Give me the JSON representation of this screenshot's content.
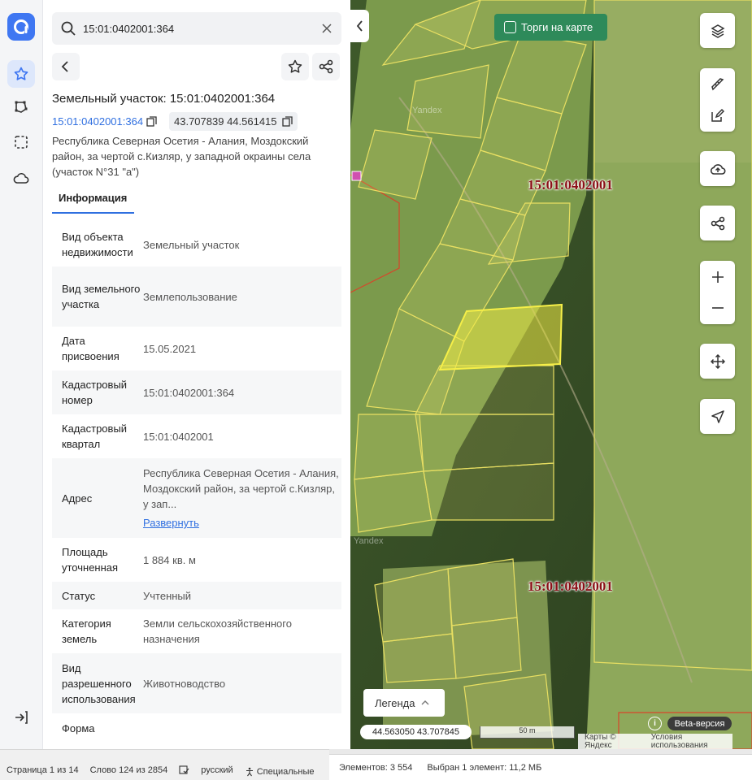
{
  "search": {
    "value": "15:01:0402001:364",
    "placeholder": ""
  },
  "object": {
    "title": "Земельный участок: 15:01:0402001:364",
    "cad_number": "15:01:0402001:364",
    "coords": "43.707839 44.561415",
    "address": "Республика Северная Осетия - Алания, Моздокский район, за чертой с.Кизляр, у западной окраины села (участок N°31 \"а\")"
  },
  "tabs": {
    "info": "Информация"
  },
  "info_rows": [
    {
      "key": "Вид объекта недвижимости",
      "value": "Земельный участок"
    },
    {
      "key": "Вид земельного участка",
      "value": "Землепользование"
    },
    {
      "key": "Дата присвоения",
      "value": "15.05.2021"
    },
    {
      "key": "Кадастровый номер",
      "value": "15:01:0402001:364"
    },
    {
      "key": "Кадастровый квартал",
      "value": "15:01:0402001"
    },
    {
      "key": "Адрес",
      "value": "Республика Северная Осетия - Алания, Моздокский район, за чертой с.Кизляр, у зап...",
      "link": "Развернуть"
    },
    {
      "key": "Площадь уточненная",
      "value": "1 884 кв. м"
    },
    {
      "key": "Статус",
      "value": "Учтенный"
    },
    {
      "key": "Категория земель",
      "value": "Земли сельскохозяйственного назначения"
    },
    {
      "key": "Вид разрешенного использования",
      "value": "Животноводство"
    },
    {
      "key": "Форма",
      "value": ""
    }
  ],
  "map": {
    "torgi_label": "Торги на карте",
    "quarter_label_1": "15:01:0402001",
    "quarter_label_2": "15:01:0402001",
    "yandex_1": "Yandex",
    "yandex_2": "Yandex",
    "legend": "Легенда",
    "cursor_coords": "44.563050  43.707845",
    "scale": "50 m",
    "beta": "Beta-версия",
    "info": "i",
    "footer_links": [
      "Карты © Яндекс",
      "Условия использования"
    ]
  },
  "word_status": {
    "page": "Страница 1 из 14",
    "word": "Слово 124 из 2854",
    "language": "русский",
    "special": "Специальные"
  },
  "sheet_status": {
    "elements": "Элементов: 3 554",
    "selected": "Выбран 1 элемент: 11,2 МБ"
  },
  "icons": {
    "logo": "app-logo-icon",
    "favorites": "star-icon",
    "polygon": "polygon-icon",
    "select": "selection-icon",
    "cloud": "cloud-icon",
    "logout": "logout-icon",
    "search": "search-icon",
    "clear": "close-icon",
    "back": "chevron-left-icon",
    "star": "star-icon",
    "share": "share-icon",
    "copy": "copy-icon",
    "layers": "layers-icon",
    "ruler": "ruler-icon",
    "edit": "edit-icon",
    "upload": "cloud-upload-icon",
    "zoom_in": "plus-icon",
    "zoom_out": "minus-icon",
    "move": "move-icon",
    "locate": "location-arrow-icon"
  },
  "colors": {
    "accent": "#3f77f2",
    "link": "#2f6fe0",
    "torgi": "#2e8a5a",
    "quarter_label": "#8b0f16",
    "parcel_outline": "#f2ea5a"
  }
}
